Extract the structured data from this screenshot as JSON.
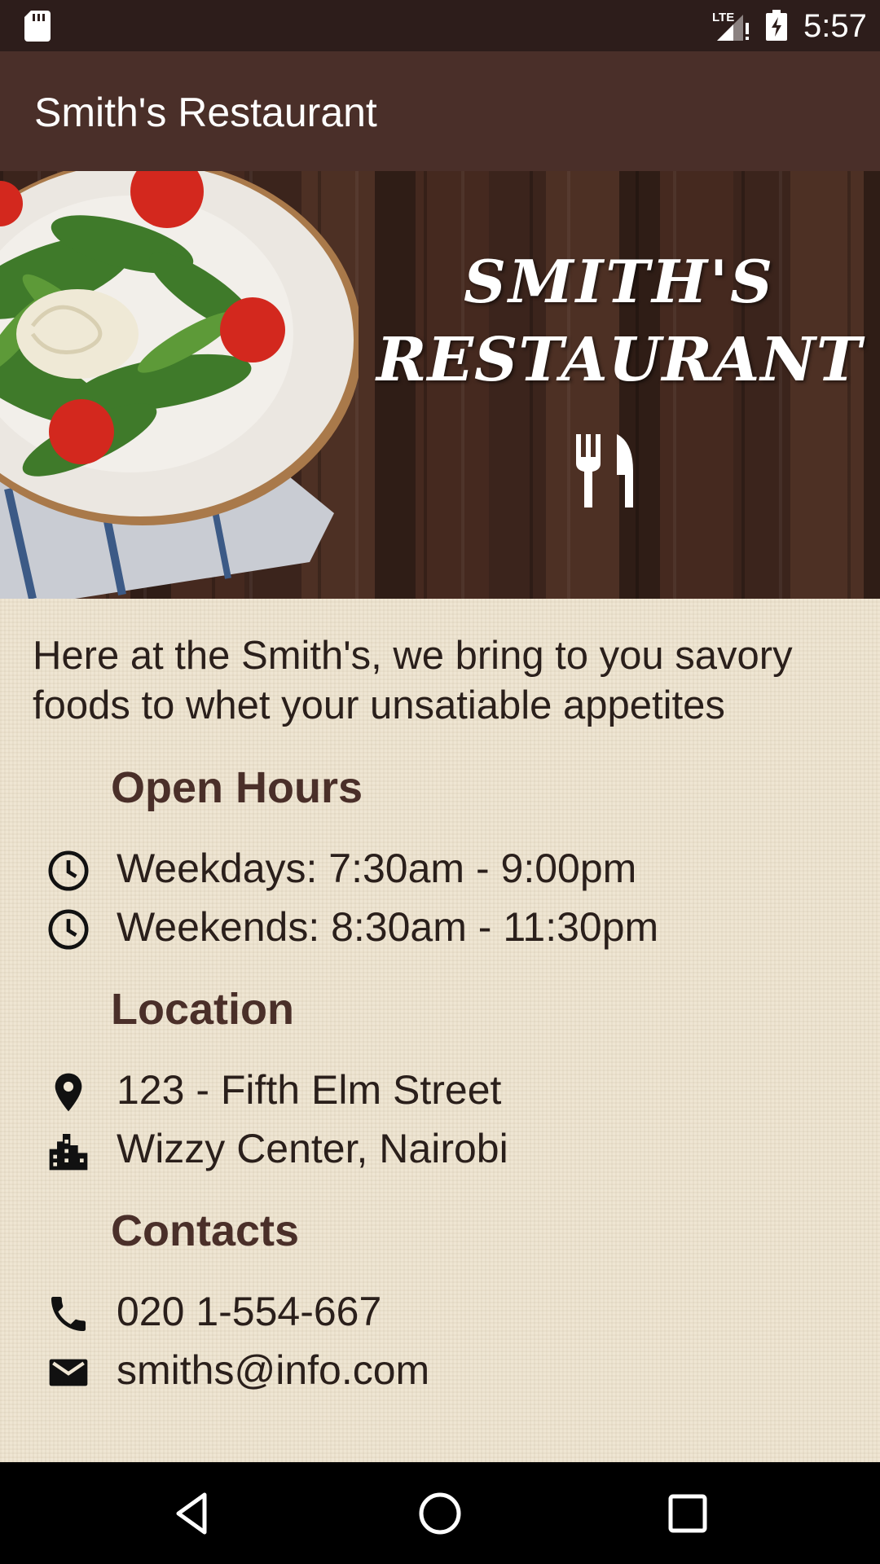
{
  "status_bar": {
    "time": "5:57",
    "icons": [
      "sd-card-icon",
      "lte-signal-icon",
      "battery-charging-icon"
    ]
  },
  "app_bar": {
    "title": "Smith's Restaurant"
  },
  "banner": {
    "brand_line1": "SMITH'S",
    "brand_line2": "RESTAURANT",
    "icon": "cutlery-icon"
  },
  "intro": "Here at the Smith's, we bring to you savory foods to whet your unsatiable appetites",
  "open_hours": {
    "heading": "Open Hours",
    "items": [
      {
        "icon": "clock-icon",
        "text": "Weekdays: 7:30am - 9:00pm"
      },
      {
        "icon": "clock-icon",
        "text": "Weekends: 8:30am - 11:30pm"
      }
    ]
  },
  "location": {
    "heading": "Location",
    "items": [
      {
        "icon": "location-pin-icon",
        "text": "123 - Fifth Elm Street"
      },
      {
        "icon": "city-icon",
        "text": "Wizzy Center, Nairobi"
      }
    ]
  },
  "contacts": {
    "heading": "Contacts",
    "items": [
      {
        "icon": "phone-icon",
        "text": "020 1-554-667"
      },
      {
        "icon": "email-icon",
        "text": "smiths@info.com"
      }
    ]
  },
  "nav_bar": {
    "buttons": [
      "back-icon",
      "home-icon",
      "recents-icon"
    ]
  },
  "colors": {
    "status_bar": "#2d1d1b",
    "app_bar": "#4a2f29",
    "heading": "#4a2f29",
    "content_bg": "#efe6d3"
  }
}
